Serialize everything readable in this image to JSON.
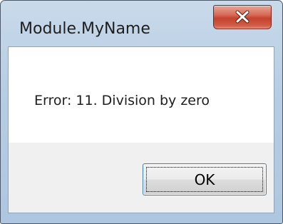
{
  "dialog": {
    "title": "Module.MyName",
    "message": "Error: 11. Division by zero",
    "ok_label": "OK",
    "close_icon": "close-x-icon"
  },
  "colors": {
    "close_button": "#c4432f",
    "titlebar": "#b7cde4",
    "button_strip": "#f0f0f0",
    "ok_border": "#3c7fb1"
  }
}
